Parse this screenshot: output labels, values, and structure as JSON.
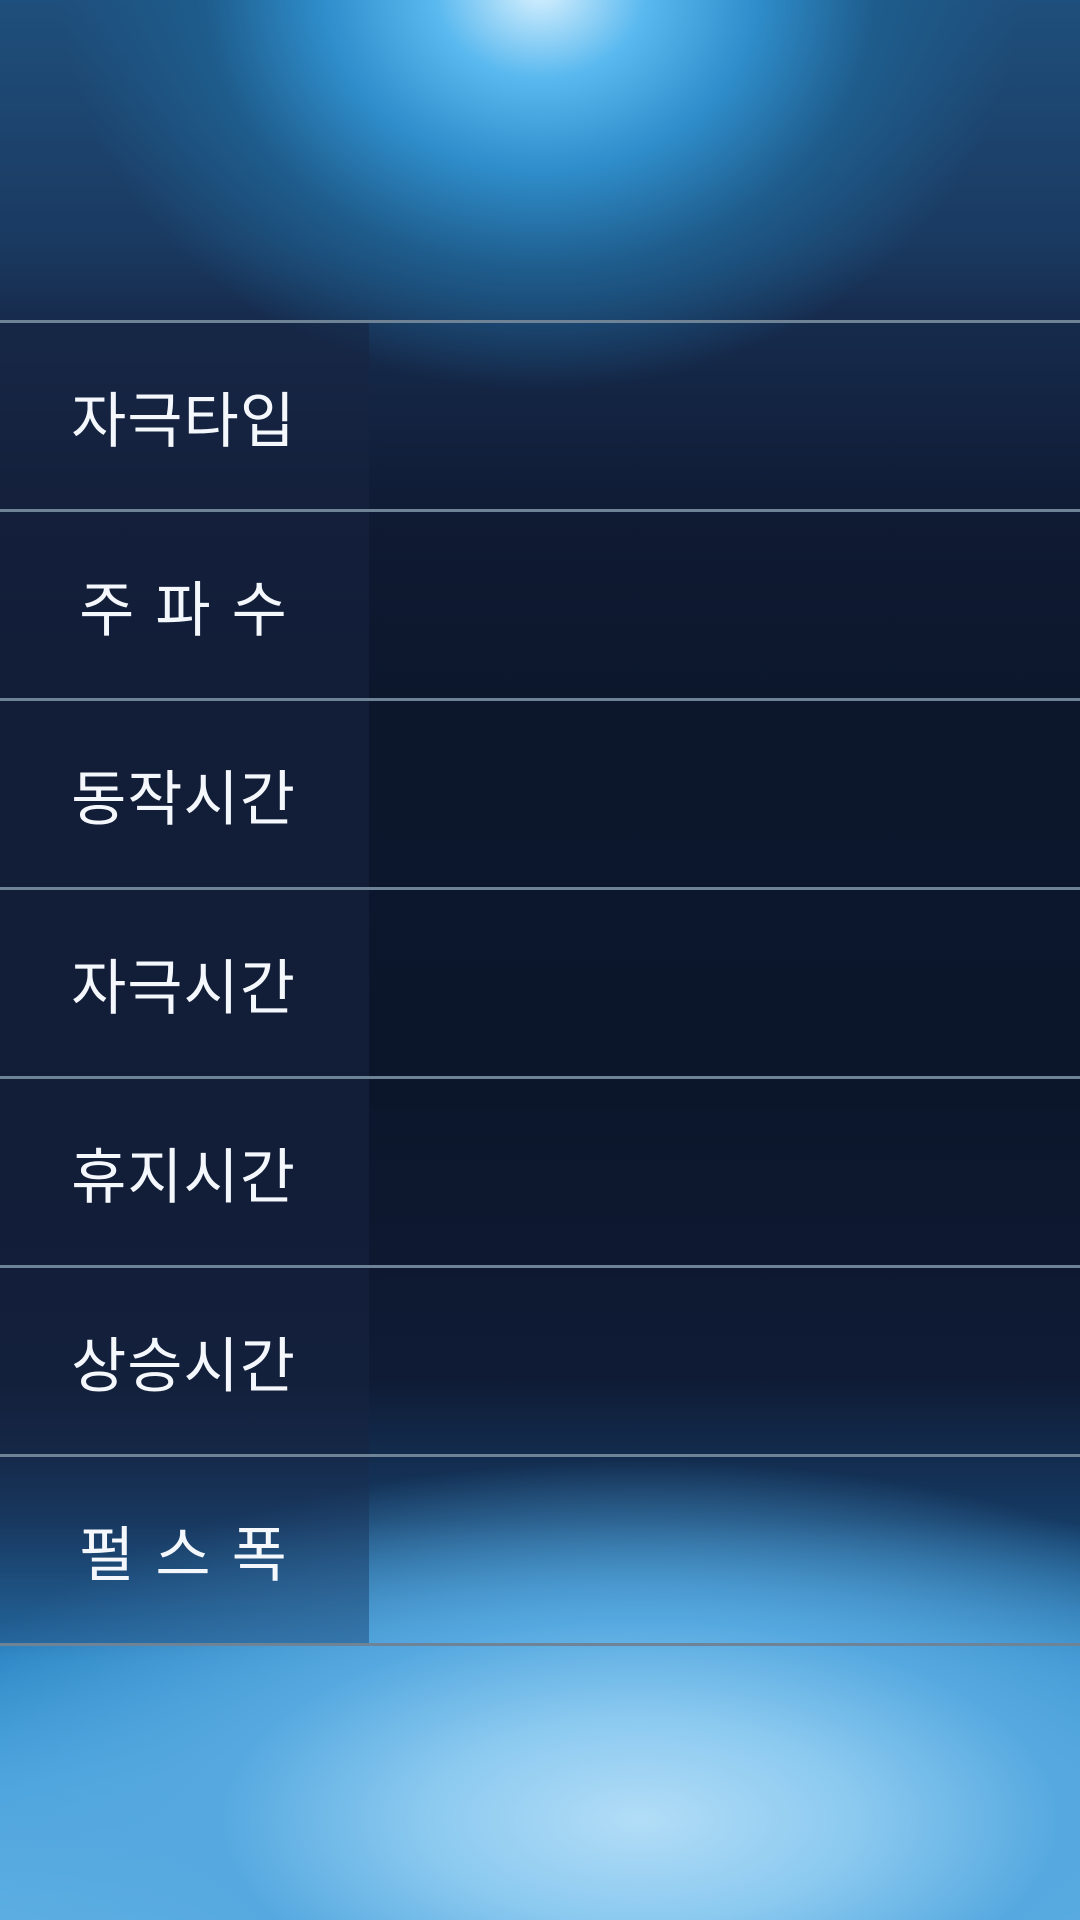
{
  "params": [
    {
      "label": "자극타입",
      "value": ""
    },
    {
      "label": "주 파 수",
      "value": ""
    },
    {
      "label": "동작시간",
      "value": ""
    },
    {
      "label": "자극시간",
      "value": ""
    },
    {
      "label": "휴지시간",
      "value": ""
    },
    {
      "label": "상승시간",
      "value": ""
    },
    {
      "label": "펄 스 폭",
      "value": ""
    }
  ],
  "colors": {
    "row_label_bg": "#182442",
    "divider": "#6f8397",
    "text": "#f4f7fb",
    "glow_top": "#5ab9ef",
    "glow_bottom": "#8ccaf0"
  }
}
